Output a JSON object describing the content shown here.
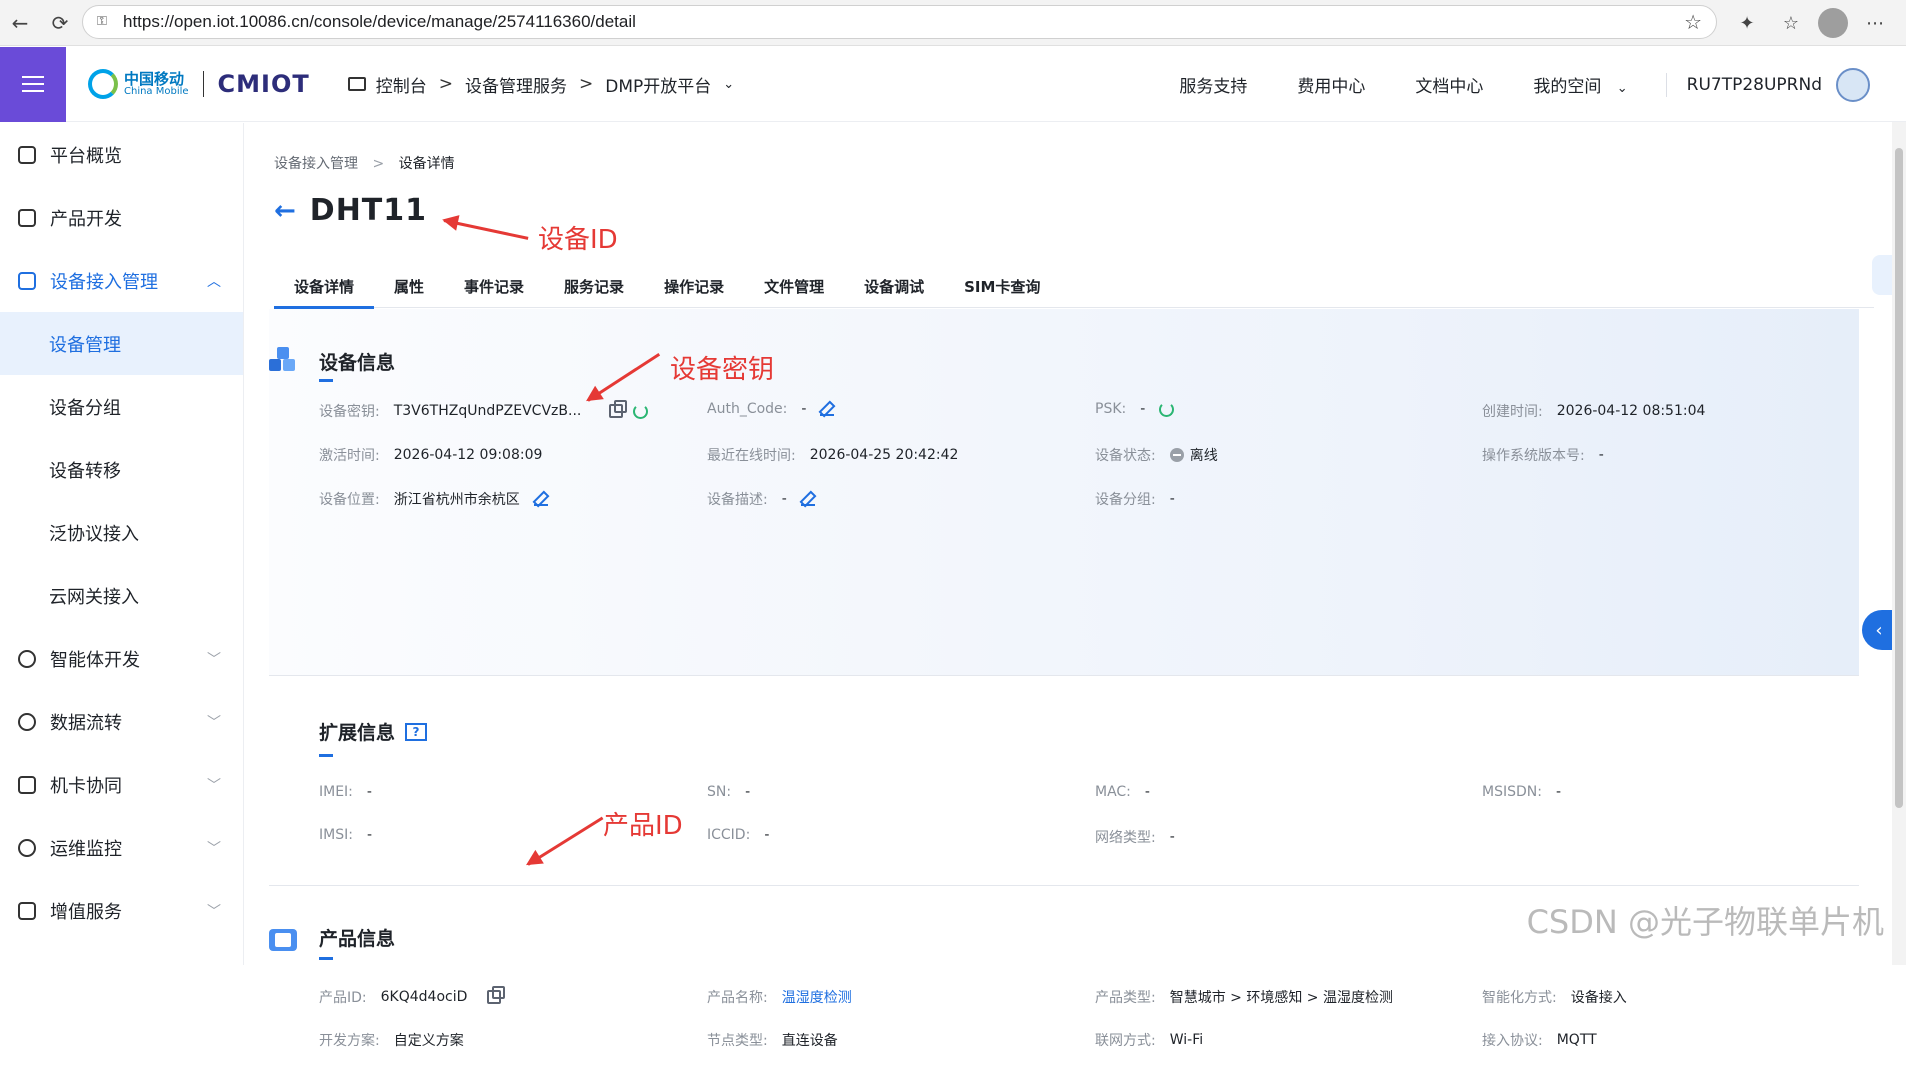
{
  "browser": {
    "url": "https://open.iot.10086.cn/console/device/manage/2574116360/detail"
  },
  "header": {
    "brand_cn": "中国移动",
    "brand_en": "China Mobile",
    "iot_logo": "CMIOT",
    "breadcrumb": [
      "控制台",
      "设备管理服务",
      "DMP开放平台"
    ],
    "links": [
      "服务支持",
      "费用中心",
      "文档中心",
      "我的空间"
    ],
    "username": "RU7TP28UPRNd"
  },
  "sidebar": {
    "items": [
      {
        "label": "平台概览",
        "icon": "dashboard-icon"
      },
      {
        "label": "产品开发",
        "icon": "cube-icon"
      },
      {
        "label": "设备接入管理",
        "icon": "device-access-icon",
        "expanded": true
      }
    ],
    "sub_items": [
      "设备管理",
      "设备分组",
      "设备转移",
      "泛协议接入",
      "云网关接入"
    ],
    "more_items": [
      {
        "label": "智能体开发",
        "icon": "agent-icon"
      },
      {
        "label": "数据流转",
        "icon": "data-flow-icon"
      },
      {
        "label": "机卡协同",
        "icon": "sim-icon"
      },
      {
        "label": "运维监控",
        "icon": "monitor-icon"
      },
      {
        "label": "增值服务",
        "icon": "value-add-icon"
      }
    ]
  },
  "page": {
    "breadcrumb": [
      "设备接入管理",
      "设备详情"
    ],
    "title": "DHT11",
    "tabs": [
      "设备详情",
      "属性",
      "事件记录",
      "服务记录",
      "操作记录",
      "文件管理",
      "设备调试",
      "SIM卡查询"
    ],
    "active_tab": "设备详情"
  },
  "device_info": {
    "title": "设备信息",
    "key_label": "设备密钥:",
    "key_value": "T3V6THZqUndPZEVCVzB...",
    "auth_label": "Auth_Code:",
    "auth_value": "-",
    "psk_label": "PSK:",
    "psk_value": "-",
    "created_label": "创建时间:",
    "created_value": "2026-04-12 08:51:04",
    "activated_label": "激活时间:",
    "activated_value": "2026-04-12 09:08:09",
    "last_online_label": "最近在线时间:",
    "last_online_value": "2026-04-25 20:42:42",
    "status_label": "设备状态:",
    "status_value": "离线",
    "os_label": "操作系统版本号:",
    "os_value": "-",
    "location_label": "设备位置:",
    "location_value": "浙江省杭州市余杭区",
    "desc_label": "设备描述:",
    "desc_value": "-",
    "group_label": "设备分组:",
    "group_value": "-"
  },
  "ext_info": {
    "title": "扩展信息",
    "help": "?",
    "imei_label": "IMEI:",
    "imei_value": "-",
    "sn_label": "SN:",
    "sn_value": "-",
    "mac_label": "MAC:",
    "mac_value": "-",
    "msisdn_label": "MSISDN:",
    "msisdn_value": "-",
    "imsi_label": "IMSI:",
    "imsi_value": "-",
    "iccid_label": "ICCID:",
    "iccid_value": "-",
    "net_label": "网络类型:",
    "net_value": "-"
  },
  "product_info": {
    "title": "产品信息",
    "pid_label": "产品ID:",
    "pid_value": "6KQ4d4ociD",
    "pname_label": "产品名称:",
    "pname_value": "温湿度检测",
    "ptype_label": "产品类型:",
    "ptype_value": "智慧城市 > 环境感知 > 温湿度检测",
    "intel_label": "智能化方式:",
    "intel_value": "设备接入",
    "dev_label": "开发方案:",
    "dev_value": "自定义方案",
    "node_label": "节点类型:",
    "node_value": "直连设备",
    "network_label": "联网方式:",
    "network_value": "Wi-Fi",
    "protocol_label": "接入协议:",
    "protocol_value": "MQTT"
  },
  "annotations": {
    "device_id": "设备ID",
    "device_key": "设备密钥",
    "product_id": "产品ID"
  },
  "watermark": "CSDN @光子物联单片机",
  "colors": {
    "accent": "#1f6fe0",
    "menu": "#6a4bd8",
    "annotation": "#e53935",
    "refresh": "#2bb673"
  }
}
